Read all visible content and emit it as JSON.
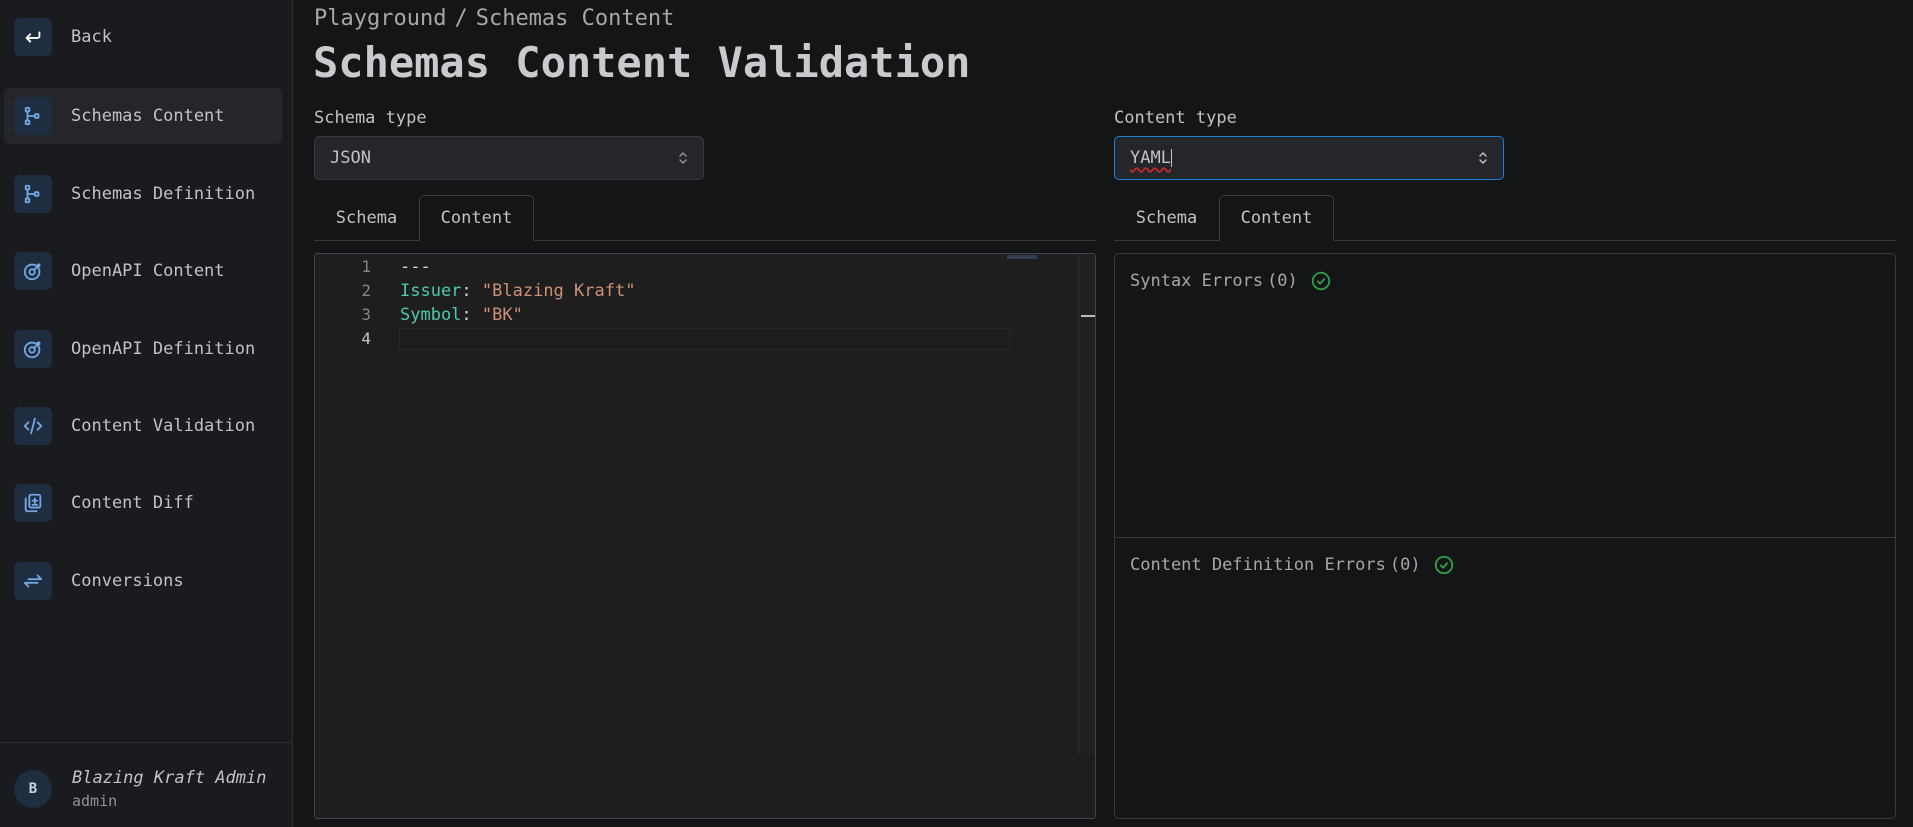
{
  "sidebar": {
    "back_label": "Back",
    "items": [
      {
        "label": "Schemas Content",
        "icon": "schema-tree-icon",
        "active": true
      },
      {
        "label": "Schemas Definition",
        "icon": "schema-tree-icon",
        "active": false
      },
      {
        "label": "OpenAPI Content",
        "icon": "openapi-icon",
        "active": false
      },
      {
        "label": "OpenAPI Definition",
        "icon": "openapi-icon",
        "active": false
      },
      {
        "label": "Content Validation",
        "icon": "code-icon",
        "active": false
      },
      {
        "label": "Content Diff",
        "icon": "file-diff-icon",
        "active": false
      },
      {
        "label": "Conversions",
        "icon": "arrows-exchange-icon",
        "active": false
      }
    ],
    "user": {
      "initial": "B",
      "name": "Blazing Kraft Admin",
      "role": "admin"
    }
  },
  "breadcrumb": {
    "root": "Playground",
    "separator": "/",
    "current": "Schemas Content"
  },
  "page_title": "Schemas Content Validation",
  "schema_type": {
    "label": "Schema type",
    "value": "JSON"
  },
  "content_type": {
    "label": "Content type",
    "value": "YAML"
  },
  "left_tabs": {
    "schema": "Schema",
    "content": "Content",
    "active": "Content"
  },
  "right_tabs": {
    "schema": "Schema",
    "content": "Content",
    "active": "Content"
  },
  "editor": {
    "lines": [
      {
        "number": "1",
        "raw": "---"
      },
      {
        "number": "2",
        "key": "Issuer",
        "value": "\"Blazing Kraft\""
      },
      {
        "number": "3",
        "key": "Symbol",
        "value": "\"BK\""
      },
      {
        "number": "4",
        "raw": ""
      }
    ],
    "colon": ": "
  },
  "results": {
    "syntax": {
      "label": "Syntax Errors",
      "count": "(0)"
    },
    "definition": {
      "label": "Content Definition Errors",
      "count": "(0)"
    }
  },
  "colors": {
    "accent": "#1c7ed6",
    "success": "#2f9e44",
    "icon": "#74a7e4"
  }
}
